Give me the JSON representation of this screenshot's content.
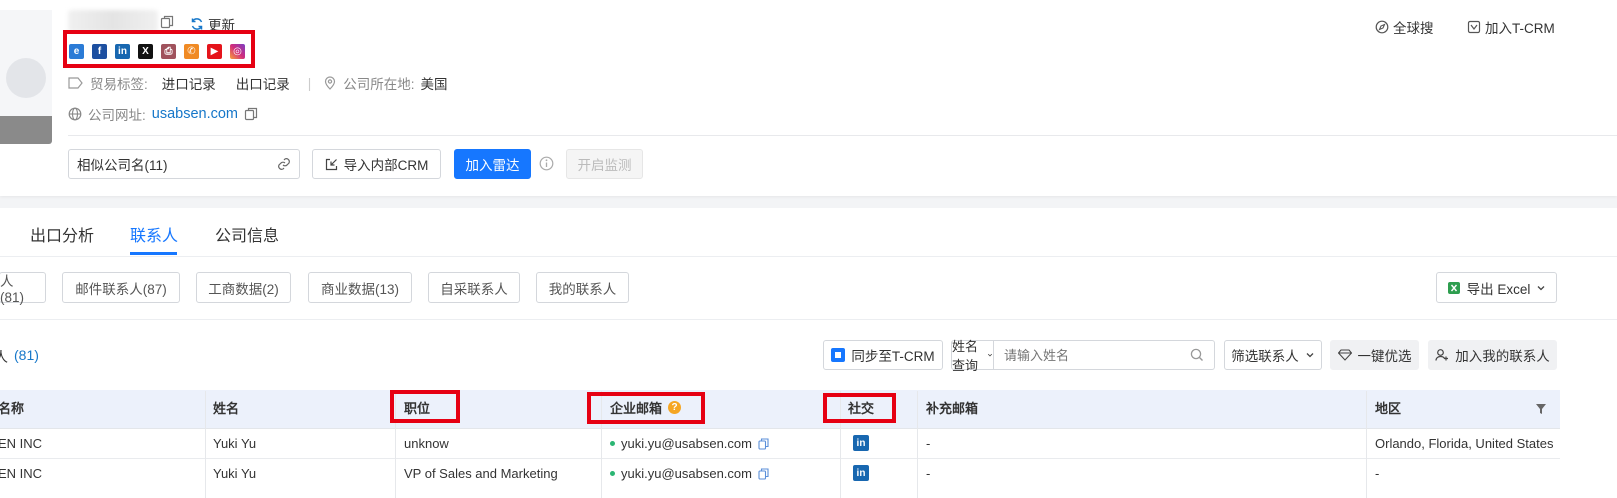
{
  "header": {
    "copy_icon": "copy-icon",
    "update_label": "更新",
    "global_search_label": "全球搜",
    "add_tcrm_label": "加入T-CRM",
    "trade_tags_label": "贸易标签:",
    "trade_tags": [
      "进口记录",
      "出口记录"
    ],
    "location_label": "公司所在地:",
    "location_value": "美国",
    "website_label": "公司网址:",
    "website_value": "usabsen.com",
    "social_icons": [
      "ie-icon",
      "facebook-icon",
      "linkedin-icon",
      "x-icon",
      "printer-icon",
      "phone-icon",
      "youtube-icon",
      "instagram-icon"
    ]
  },
  "actions": {
    "similar_companies_value": "相似公司名(11)",
    "import_crm_label": "导入内部CRM",
    "add_radar_label": "加入雷达",
    "start_monitor_label": "开启监测"
  },
  "tabs": [
    {
      "label": "出口分析",
      "active": false
    },
    {
      "label": "联系人",
      "active": true
    },
    {
      "label": "公司信息",
      "active": false
    }
  ],
  "filters": [
    {
      "label": "人(81)"
    },
    {
      "label": "邮件联系人(87)"
    },
    {
      "label": "工商数据(2)"
    },
    {
      "label": "商业数据(13)"
    },
    {
      "label": "自采联系人"
    },
    {
      "label": "我的联系人"
    }
  ],
  "export_label": "导出 Excel",
  "toolbar": {
    "count_label": "人",
    "count_value": "(81)",
    "sync_label": "同步至T-CRM",
    "name_query_label": "姓名查询",
    "name_input_placeholder": "请输入姓名",
    "filter_contacts_label": "筛选联系人",
    "one_click_label": "一键优选",
    "add_my_contacts_label": "加入我的联系人"
  },
  "table": {
    "columns": [
      "名称",
      "姓名",
      "职位",
      "企业邮箱",
      "社交",
      "补充邮箱",
      "地区"
    ],
    "rows": [
      {
        "company": "EN INC",
        "name": "Yuki Yu",
        "position": "unknow",
        "email": "yuki.yu@usabsen.com",
        "social": "linkedin",
        "extra_email": "-",
        "region": "Orlando, Florida, United States"
      },
      {
        "company": "EN INC",
        "name": "Yuki Yu",
        "position": "VP of Sales and Marketing",
        "email": "yuki.yu@usabsen.com",
        "social": "linkedin",
        "extra_email": "-",
        "region": "-"
      }
    ]
  },
  "colors": {
    "accent": "#1677ff",
    "link": "#1677c9",
    "highlight_border": "#e60012",
    "status_dot": "#2bb673",
    "header_row_bg": "#ecf1fb"
  }
}
